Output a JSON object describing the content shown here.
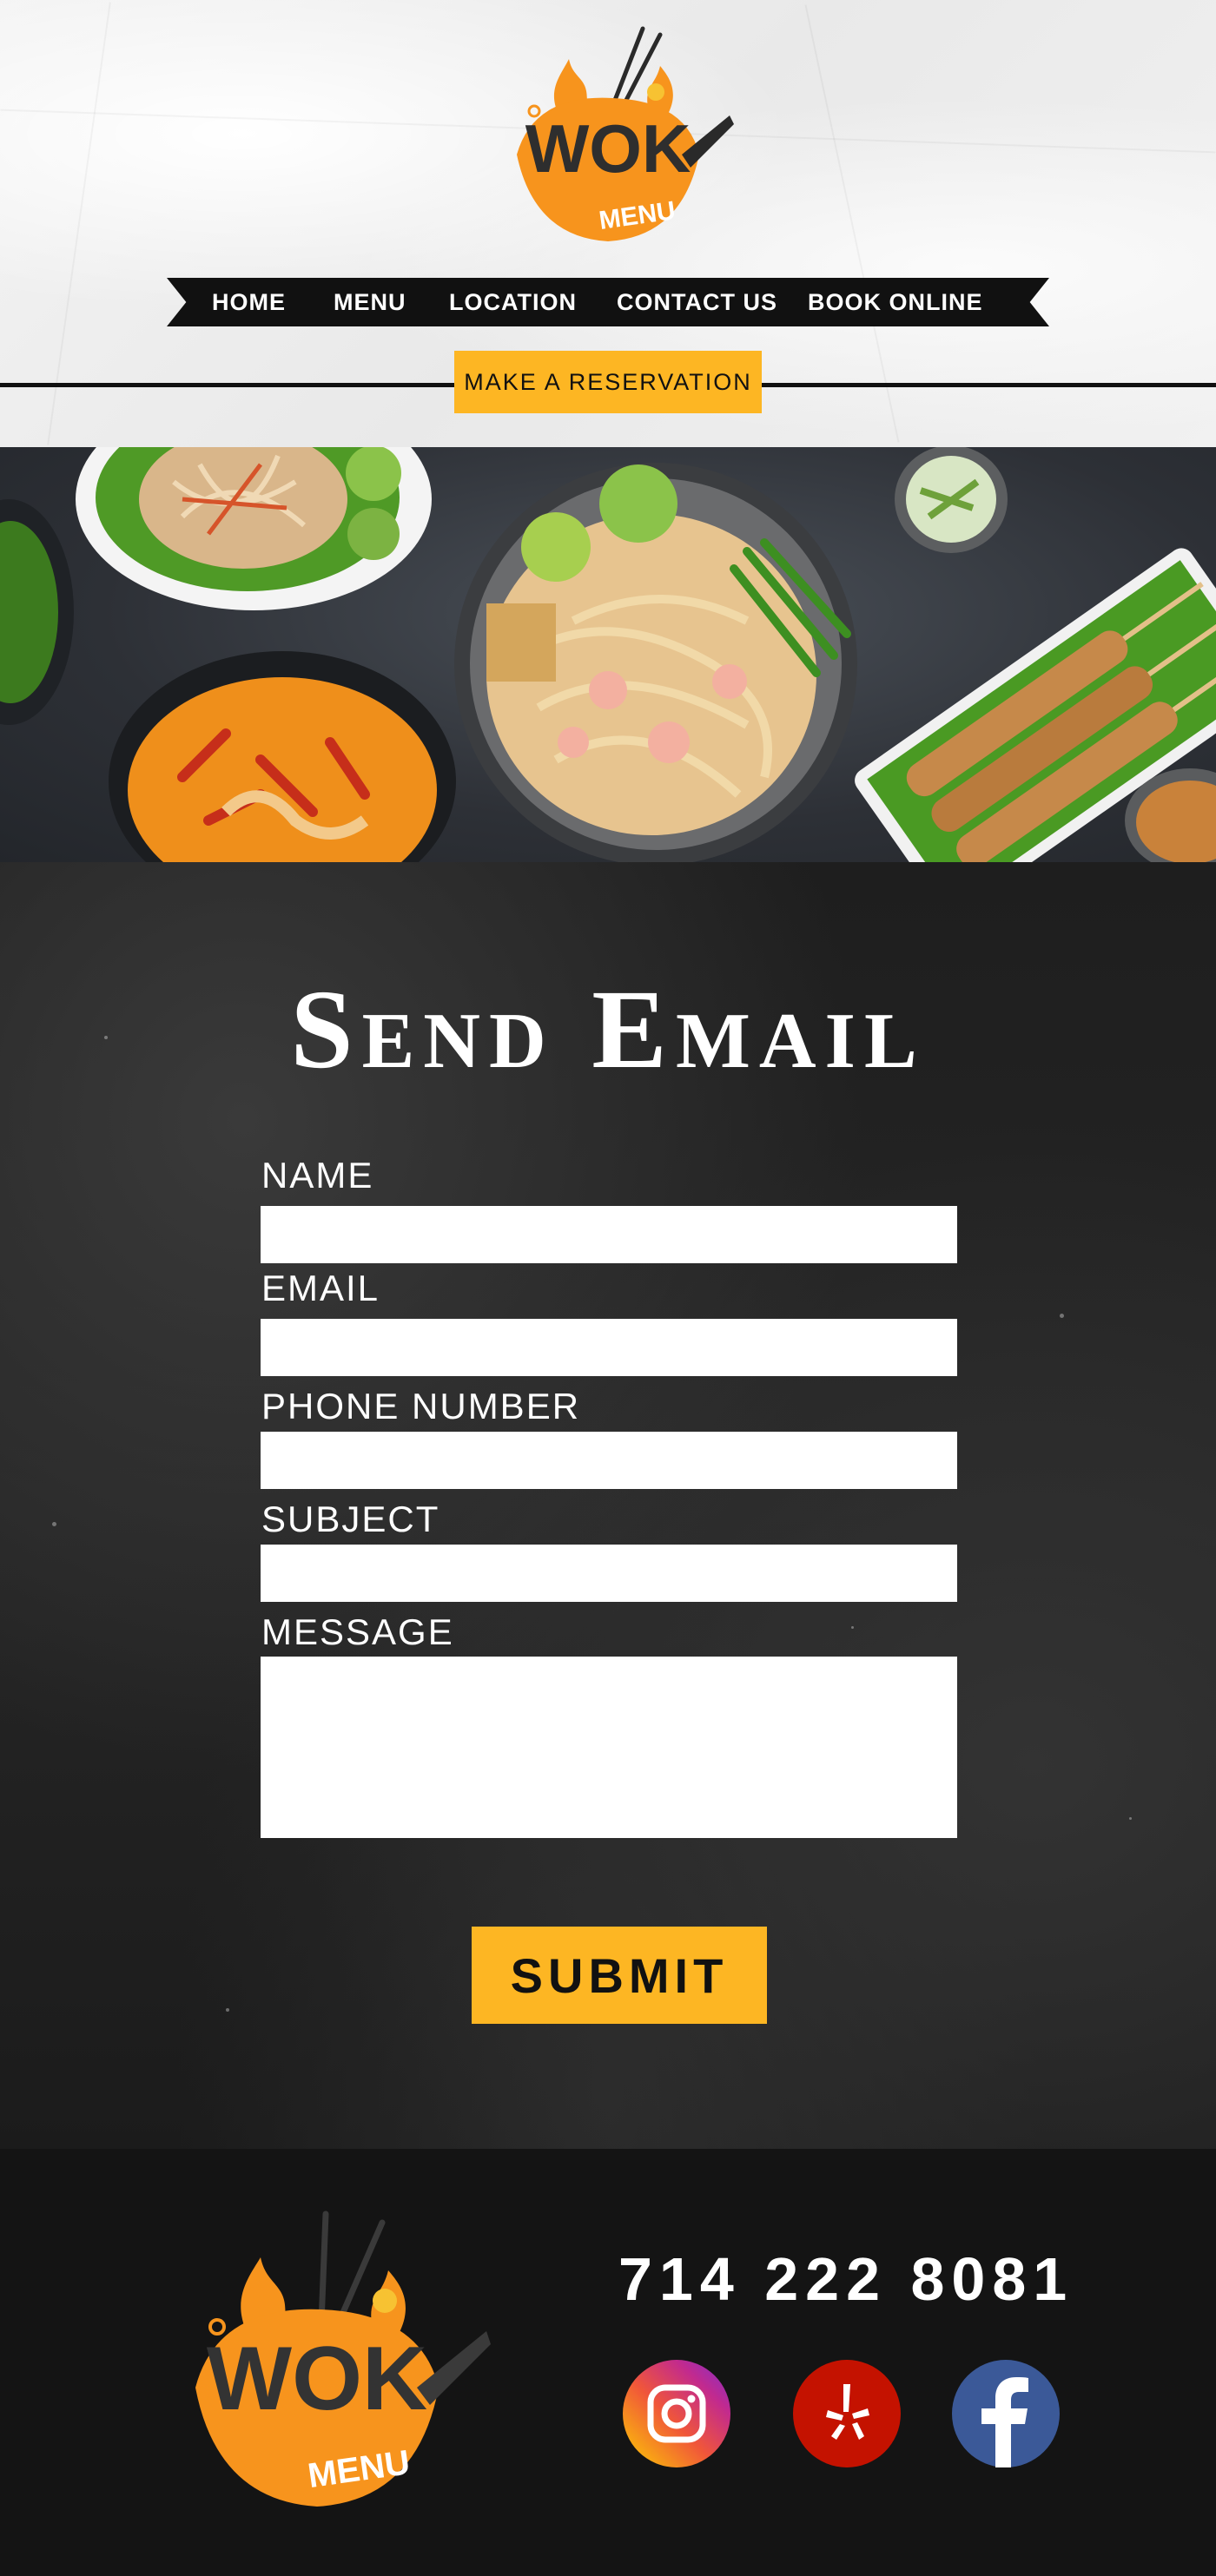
{
  "brand": {
    "logo_text": "WOK",
    "logo_subtext": "MENU"
  },
  "nav": {
    "items": [
      {
        "label": "HOME"
      },
      {
        "label": "MENU"
      },
      {
        "label": "LOCATION"
      },
      {
        "label": "CONTACT US"
      },
      {
        "label": "BOOK ONLINE"
      }
    ]
  },
  "reservation": {
    "label": "MAKE A RESERVATION"
  },
  "form": {
    "title": "Send Email",
    "fields": [
      {
        "label": "NAME",
        "value": ""
      },
      {
        "label": "EMAIL",
        "value": ""
      },
      {
        "label": "PHONE NUMBER",
        "value": ""
      },
      {
        "label": "SUBJECT",
        "value": ""
      },
      {
        "label": "MESSAGE",
        "value": ""
      }
    ],
    "submit_label": "SUBMIT"
  },
  "footer": {
    "phone": "714 222 8081",
    "social": [
      {
        "icon": "instagram-icon"
      },
      {
        "icon": "yelp-icon"
      },
      {
        "icon": "facebook-icon"
      }
    ]
  },
  "colors": {
    "accent": "#fdb623",
    "logo_orange": "#f7941d",
    "dark": "#111111",
    "yelp_red": "#c41200",
    "facebook_blue": "#3b5998"
  }
}
